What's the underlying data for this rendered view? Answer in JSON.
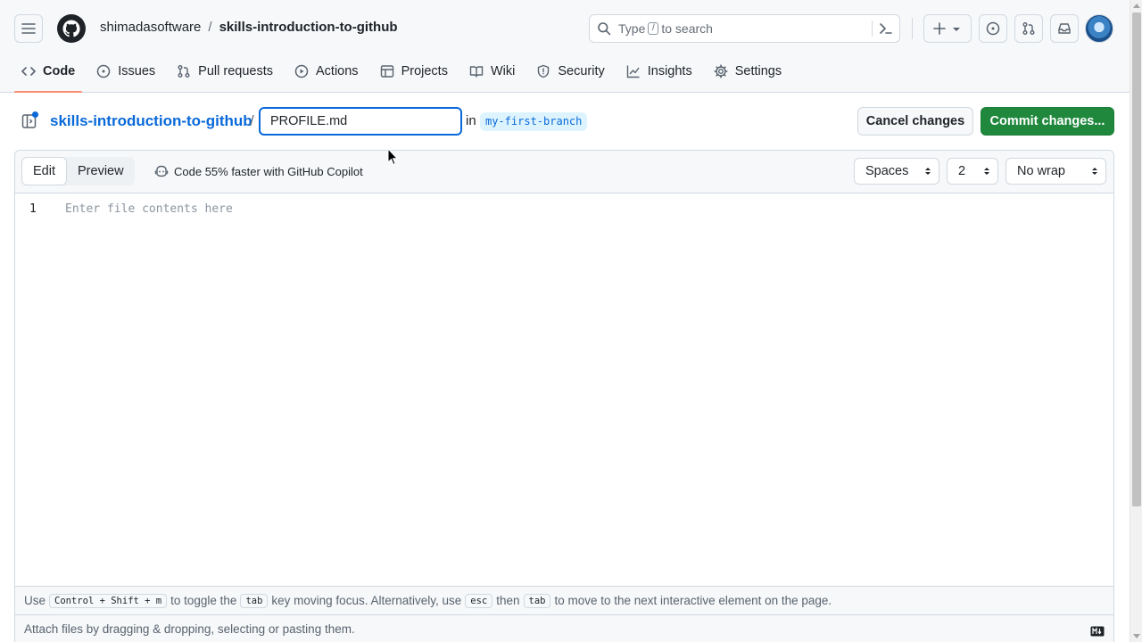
{
  "header": {
    "owner": "shimadasoftware",
    "separator": "/",
    "repo": "skills-introduction-to-github",
    "search_placeholder_before": "Type",
    "search_placeholder_key": "/",
    "search_placeholder_after": "to search",
    "icons": [
      "hamburger-icon",
      "github-logo-icon",
      "search-icon",
      "command-palette-icon",
      "plus-icon",
      "chevron-down-icon",
      "issue-icon",
      "pull-request-icon",
      "inbox-icon",
      "avatar"
    ]
  },
  "tabs": [
    {
      "label": "Code",
      "icon": "code-icon",
      "active": true
    },
    {
      "label": "Issues",
      "icon": "issue-opened-icon"
    },
    {
      "label": "Pull requests",
      "icon": "git-pull-request-icon"
    },
    {
      "label": "Actions",
      "icon": "play-icon"
    },
    {
      "label": "Projects",
      "icon": "table-icon"
    },
    {
      "label": "Wiki",
      "icon": "book-icon"
    },
    {
      "label": "Security",
      "icon": "shield-icon"
    },
    {
      "label": "Insights",
      "icon": "graph-icon"
    },
    {
      "label": "Settings",
      "icon": "gear-icon"
    }
  ],
  "editor_header": {
    "repo_link": "skills-introduction-to-github",
    "path_separator": "/",
    "filename": "PROFILE.md",
    "in_label": "in",
    "branch": "my-first-branch",
    "cancel_label": "Cancel changes",
    "commit_label": "Commit changes..."
  },
  "editor": {
    "edit_label": "Edit",
    "preview_label": "Preview",
    "copilot_label": "Code 55% faster with GitHub Copilot",
    "indent_mode": "Spaces",
    "indent_size": "2",
    "wrap_mode": "No wrap",
    "line_number": "1",
    "placeholder": "Enter file contents here"
  },
  "footer": {
    "hint_use": "Use",
    "hint_keys": "Control + Shift + m",
    "hint_toggle": "to toggle the",
    "hint_tab": "tab",
    "hint_moving": "key moving focus. Alternatively, use",
    "hint_esc": "esc",
    "hint_then": "then",
    "hint_tab2": "tab",
    "hint_end": "to move to the next interactive element on the page.",
    "attach_text": "Attach files by dragging & dropping, selecting or pasting them."
  },
  "colors": {
    "accent": "#0969da",
    "primary_button": "#1f883d",
    "active_tab_underline": "#fd8c73",
    "branch_badge_bg": "#ddf4ff"
  }
}
